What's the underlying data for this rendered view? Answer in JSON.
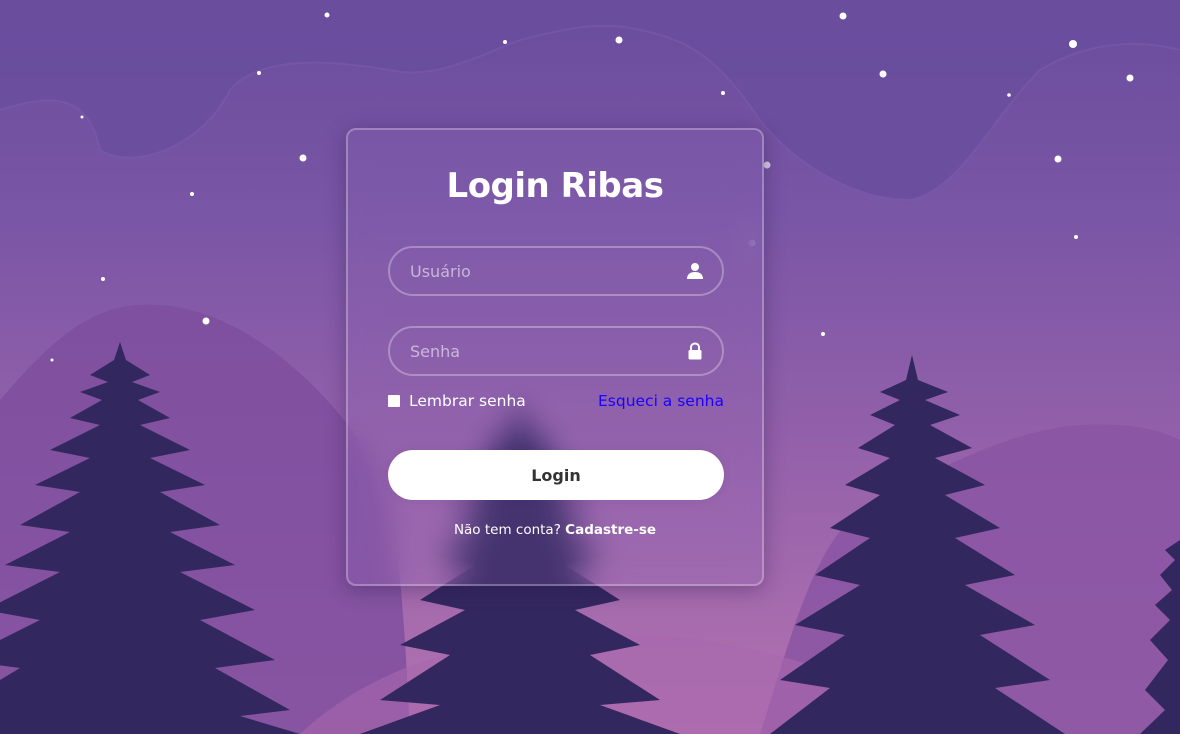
{
  "login": {
    "title": "Login Ribas",
    "username": {
      "placeholder": "Usuário",
      "value": "",
      "icon": "user-icon"
    },
    "password": {
      "placeholder": "Senha",
      "value": "",
      "icon": "lock-icon"
    },
    "remember_label": "Lembrar senha",
    "remember_checked": false,
    "forgot_label": "Esqueci a senha",
    "submit_label": "Login",
    "register_prompt": "Não tem conta?",
    "register_link": "Cadastre-se"
  },
  "colors": {
    "background_top": "#6a4c9c",
    "background_bottom": "#b373b0",
    "trees": "#33275f",
    "link": "#1a00ff",
    "button": "#ffffff"
  }
}
